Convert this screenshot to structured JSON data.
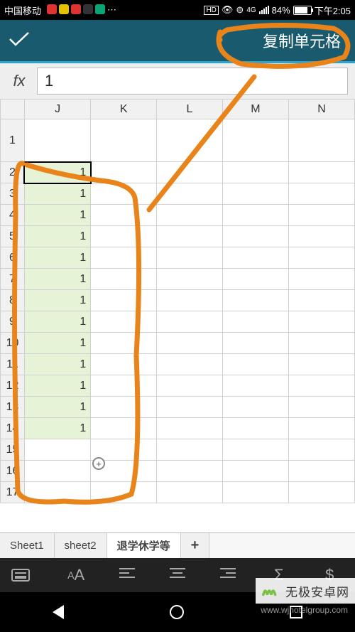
{
  "status": {
    "carrier": "中国移动",
    "hd": "HD",
    "net": "4G",
    "battery_pct": "84%",
    "time": "下午2:05"
  },
  "appbar": {
    "confirm_icon": "✓",
    "copy_cell_label": "复制单元格"
  },
  "formula": {
    "fx_label": "fx",
    "value": "1"
  },
  "sheet": {
    "columns": [
      "J",
      "K",
      "L",
      "M",
      "N"
    ],
    "row_header_start": 1,
    "rows": [
      {
        "n": 1,
        "J": "",
        "tall": true
      },
      {
        "n": 2,
        "J": "1",
        "active": true
      },
      {
        "n": 3,
        "J": "1"
      },
      {
        "n": 4,
        "J": "1"
      },
      {
        "n": 5,
        "J": "1"
      },
      {
        "n": 6,
        "J": "1"
      },
      {
        "n": 7,
        "J": "1"
      },
      {
        "n": 8,
        "J": "1"
      },
      {
        "n": 9,
        "J": "1"
      },
      {
        "n": 10,
        "J": "1"
      },
      {
        "n": 11,
        "J": "1"
      },
      {
        "n": 12,
        "J": "1"
      },
      {
        "n": 13,
        "J": "1"
      },
      {
        "n": 14,
        "J": "1"
      },
      {
        "n": 15,
        "J": ""
      },
      {
        "n": 16,
        "J": ""
      },
      {
        "n": 17,
        "J": ""
      }
    ],
    "selection": {
      "col": "J",
      "from_row": 2,
      "to_row": 14
    },
    "fill_handle_glyph": "+"
  },
  "tabs": {
    "items": [
      "Sheet1",
      "sheet2",
      "退学休学等"
    ],
    "active_index": 2,
    "add_label": "+"
  },
  "toolbar": {
    "font_label": "A",
    "font_sub": "A",
    "sigma": "Σ",
    "dollar": "$"
  },
  "watermark": {
    "text": "无极安卓网",
    "url": "www.wjhotelgroup.com"
  }
}
